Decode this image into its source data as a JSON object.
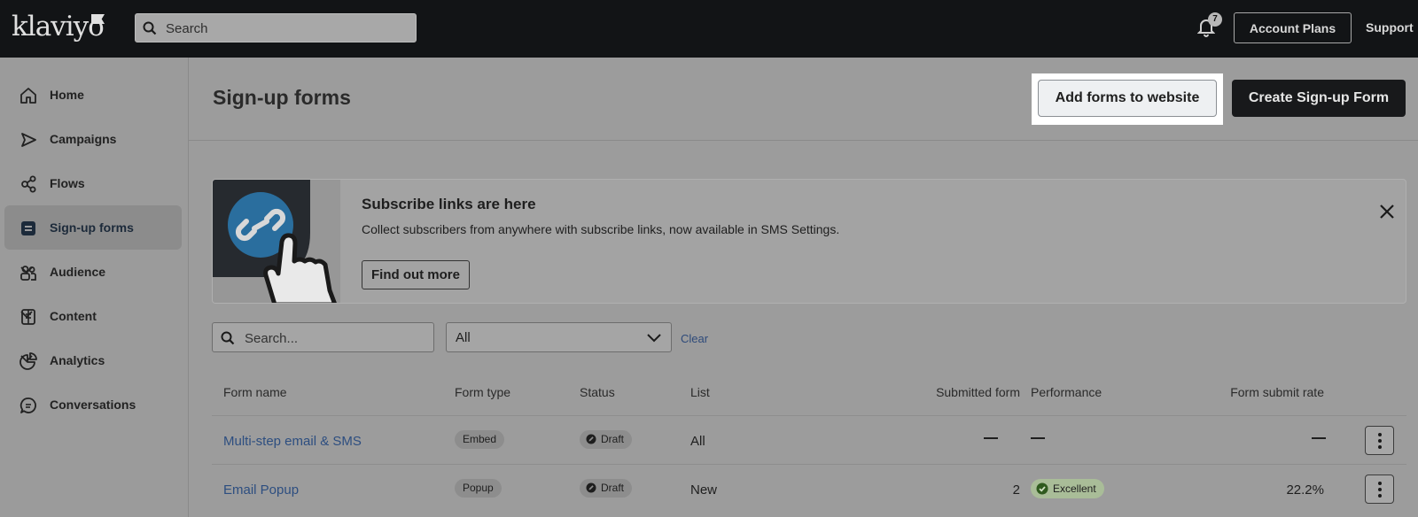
{
  "topbar": {
    "logo": "klaviyo",
    "search_placeholder": "Search",
    "notification_count": "7",
    "account_plans": "Account Plans",
    "support": "Support"
  },
  "sidebar": {
    "items": [
      {
        "label": "Home",
        "icon": "home-icon"
      },
      {
        "label": "Campaigns",
        "icon": "send-icon"
      },
      {
        "label": "Flows",
        "icon": "flows-icon"
      },
      {
        "label": "Sign-up forms",
        "icon": "form-icon",
        "active": true
      },
      {
        "label": "Audience",
        "icon": "audience-icon",
        "expandable": true
      },
      {
        "label": "Content",
        "icon": "content-icon",
        "expandable": true
      },
      {
        "label": "Analytics",
        "icon": "analytics-icon",
        "expandable": true
      },
      {
        "label": "Conversations",
        "icon": "chat-icon"
      }
    ]
  },
  "page": {
    "title": "Sign-up forms",
    "add_forms_button": "Add forms to website",
    "create_button": "Create Sign-up Form"
  },
  "banner": {
    "title": "Subscribe links are here",
    "description": "Collect subscribers from anywhere with subscribe links, now available in SMS Settings.",
    "button": "Find out more"
  },
  "filters": {
    "search_placeholder": "Search...",
    "select_value": "All",
    "clear": "Clear"
  },
  "table": {
    "columns": [
      "Form name",
      "Form type",
      "Status",
      "List",
      "Submitted form",
      "Performance",
      "Form submit rate"
    ],
    "rows": [
      {
        "name": "Multi-step email & SMS",
        "type": "Embed",
        "status": "Draft",
        "list": "All",
        "submitted": "—",
        "performance": "—",
        "rate": "—"
      },
      {
        "name": "Email Popup",
        "type": "Popup",
        "status": "Draft",
        "list": "New",
        "submitted": "2",
        "performance": "Excellent",
        "rate": "22.2%"
      }
    ]
  },
  "colors": {
    "topbar": "#121416",
    "overlay_background": "#9c9c9c",
    "primary_button": "#18191b",
    "link": "#2d4e80",
    "excellent_badge": "#a9bd98"
  }
}
